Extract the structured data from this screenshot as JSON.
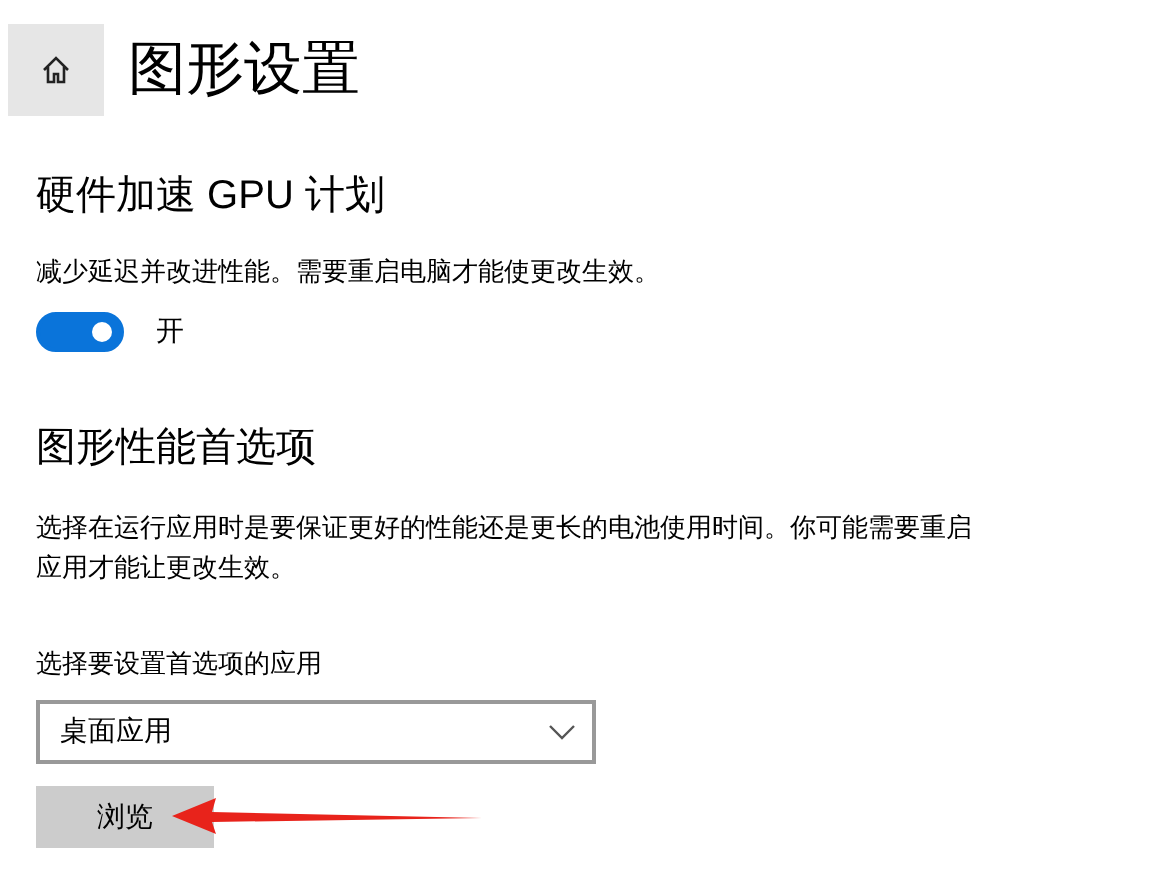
{
  "header": {
    "title": "图形设置"
  },
  "gpu_scheduling": {
    "heading": "硬件加速 GPU 计划",
    "description": "减少延迟并改进性能。需要重启电脑才能使更改生效。",
    "toggle": {
      "on": true,
      "label": "开"
    }
  },
  "graphics_preference": {
    "heading": "图形性能首选项",
    "description": "选择在运行应用时是要保证更好的性能还是更长的电池使用时间。你可能需要重启应用才能让更改生效。",
    "select_label": "选择要设置首选项的应用",
    "select_value": "桌面应用",
    "button": "浏览"
  }
}
